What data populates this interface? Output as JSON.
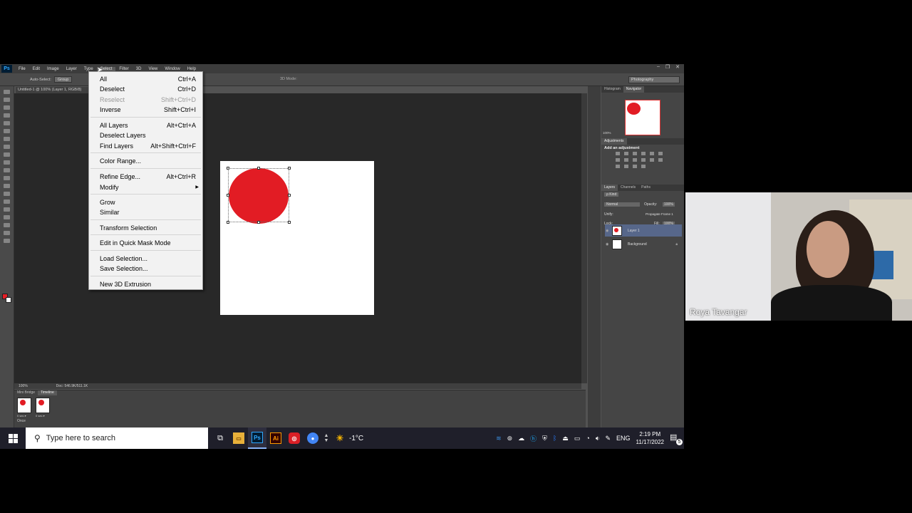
{
  "app": {
    "logo": "Ps"
  },
  "menubar": [
    "File",
    "Edit",
    "Image",
    "Layer",
    "Type",
    "Select",
    "Filter",
    "3D",
    "View",
    "Window",
    "Help"
  ],
  "window_controls": [
    "–",
    "❐",
    "✕"
  ],
  "options": {
    "auto_select_label": "Auto-Select:",
    "auto_select_value": "Group",
    "mode_3d": "3D Mode:",
    "workspace": "Photography"
  },
  "document_tab": "Untitled-1 @ 100% (Layer 1, RGB/8)",
  "status": {
    "zoom": "100%",
    "doc": "Doc: 546.9K/511.1K"
  },
  "timeline": {
    "tabs": [
      "Mini Bridge",
      "Timeline"
    ],
    "frames": [
      "0 sec.▾",
      "0 sec.▾"
    ],
    "loop": "Once"
  },
  "panels": {
    "nav_tabs": [
      "Histogram",
      "Navigator"
    ],
    "nav_zoom": "100%",
    "adj_tabs": [
      "Adjustments"
    ],
    "adj_title": "Add an adjustment",
    "layer_tabs": [
      "Layers",
      "Channels",
      "Paths"
    ],
    "kind": "ρ Kind",
    "blend": "Normal",
    "opacity_label": "Opacity:",
    "opacity": "100%",
    "unify_label": "Unify:",
    "propagate": "Propagate Frame 1",
    "lock_label": "Lock:",
    "fill_label": "Fill:",
    "fill": "100%",
    "layers": [
      "Layer 1",
      "Background"
    ]
  },
  "select_menu": {
    "items": [
      {
        "label": "All",
        "shortcut": "Ctrl+A",
        "disabled": false
      },
      {
        "label": "Deselect",
        "shortcut": "Ctrl+D",
        "disabled": false
      },
      {
        "label": "Reselect",
        "shortcut": "Shift+Ctrl+D",
        "disabled": true
      },
      {
        "label": "Inverse",
        "shortcut": "Shift+Ctrl+I",
        "disabled": false
      },
      {
        "label": "All Layers",
        "shortcut": "Alt+Ctrl+A",
        "disabled": false
      },
      {
        "label": "Deselect Layers",
        "shortcut": "",
        "disabled": false
      },
      {
        "label": "Find Layers",
        "shortcut": "Alt+Shift+Ctrl+F",
        "disabled": false
      },
      {
        "label": "Color Range...",
        "shortcut": "",
        "disabled": false
      },
      {
        "label": "Refine Edge...",
        "shortcut": "Alt+Ctrl+R",
        "disabled": false
      },
      {
        "label": "Modify",
        "shortcut": "",
        "disabled": false
      },
      {
        "label": "Grow",
        "shortcut": "",
        "disabled": false
      },
      {
        "label": "Similar",
        "shortcut": "",
        "disabled": false
      },
      {
        "label": "Transform Selection",
        "shortcut": "",
        "disabled": false
      },
      {
        "label": "Edit in Quick Mask Mode",
        "shortcut": "",
        "disabled": false
      },
      {
        "label": "Load Selection...",
        "shortcut": "",
        "disabled": false
      },
      {
        "label": "Save Selection...",
        "shortcut": "",
        "disabled": false
      },
      {
        "label": "New 3D Extrusion",
        "shortcut": "",
        "disabled": false
      }
    ]
  },
  "taskbar": {
    "search_placeholder": "Type here to search",
    "apps": [
      "Ps",
      "Ai"
    ],
    "weather": "-1°C",
    "lang": "ENG",
    "time": "2:19 PM",
    "date": "11/17/2022",
    "notifications": "5"
  },
  "webcam": {
    "name": "Roya Tavangar"
  },
  "colors": {
    "shape": "#e21c24",
    "ps_bg": "#535353",
    "canvas_bg": "#282828"
  }
}
